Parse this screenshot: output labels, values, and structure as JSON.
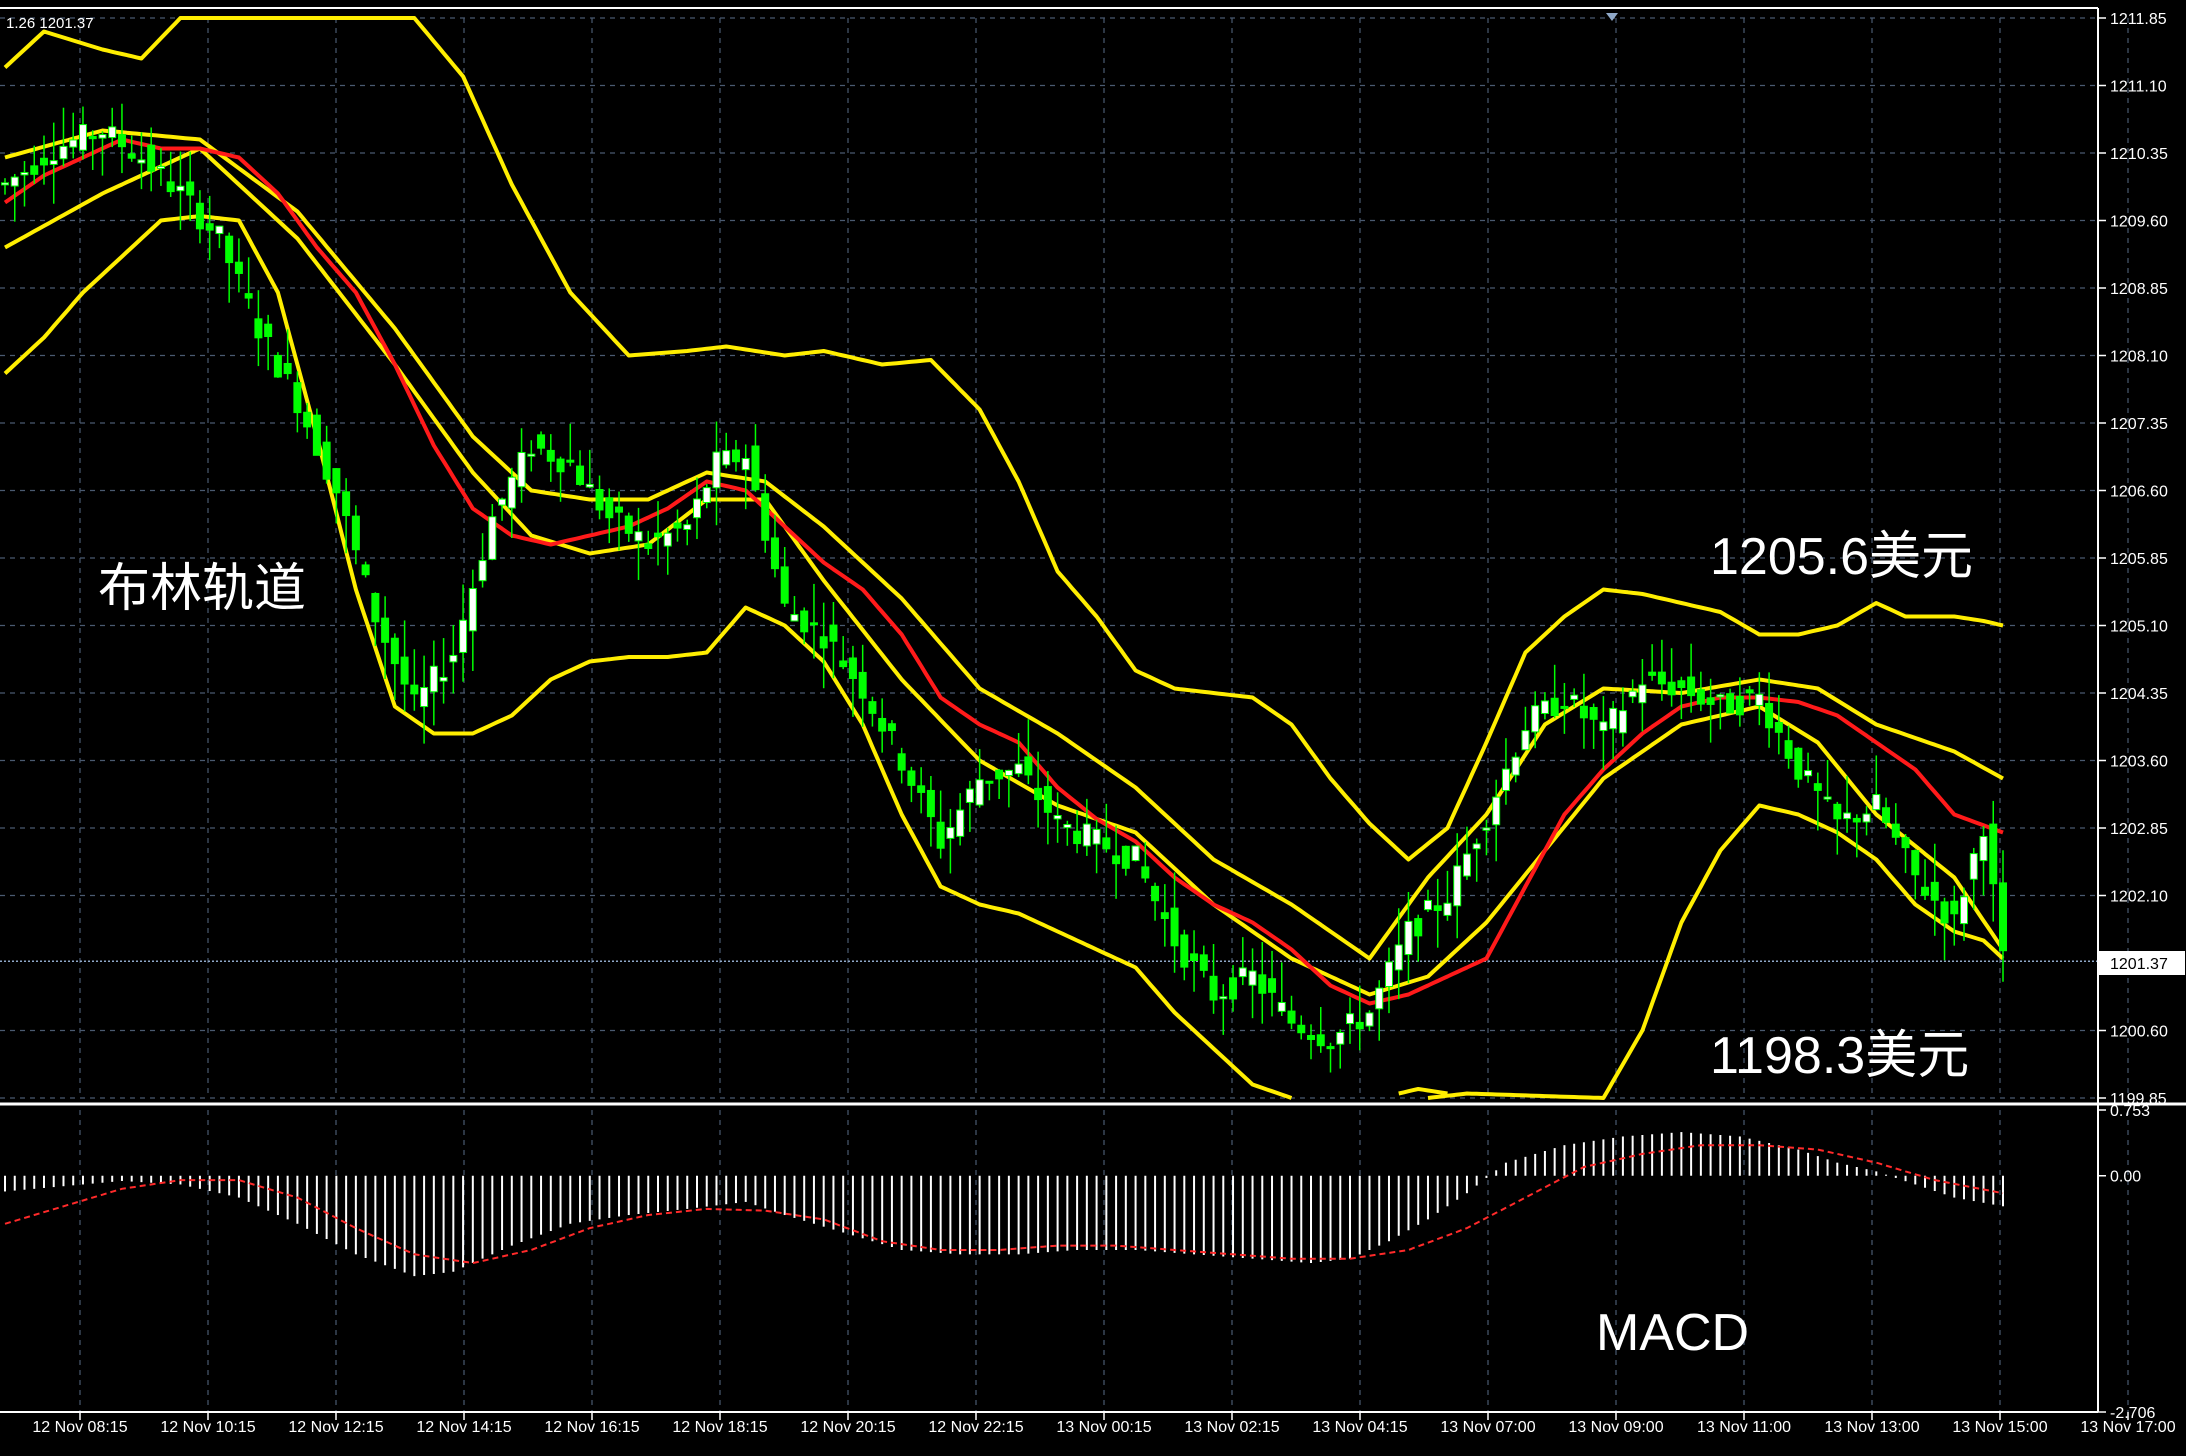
{
  "colors": {
    "background": "#000000",
    "grid": "#4a5a70",
    "axis": "#ffffff",
    "bull_candle": "#ffffff",
    "bear_candle": "#00ff00",
    "wick": "#00ff00",
    "bollinger": "#ffee00",
    "middle_band": "#ff1a1a",
    "macd_hist": "#ffffff",
    "macd_signal": "#ff2a2a",
    "current_price_line": "#8fa8c8",
    "annotation_text": "#ffffff"
  },
  "header": {
    "ohlc_text": "1.26 1201.37"
  },
  "annotations": {
    "bollinger_label": "布林轨道",
    "upper_price_label": "1205.6美元",
    "lower_price_label": "1198.3美元",
    "macd_label": "MACD"
  },
  "current_price": {
    "value": 1201.37,
    "label": "1201.37"
  },
  "chart_data": [
    {
      "type": "candlestick",
      "indicator": "Bollinger Bands",
      "ylim": [
        1199.85,
        1211.85
      ],
      "y_ticks": [
        "1211.85",
        "1211.10",
        "1210.35",
        "1209.60",
        "1208.85",
        "1208.10",
        "1207.35",
        "1206.60",
        "1205.85",
        "1205.10",
        "1204.35",
        "1203.60",
        "1202.85",
        "1202.10",
        "1201.37",
        "1200.60",
        "1199.85"
      ],
      "x_ticks": [
        "12 Nov 08:15",
        "12 Nov 10:15",
        "12 Nov 12:15",
        "12 Nov 14:15",
        "12 Nov 16:15",
        "12 Nov 18:15",
        "12 Nov 20:15",
        "12 Nov 22:15",
        "13 Nov 00:15",
        "13 Nov 02:15",
        "13 Nov 04:15",
        "13 Nov 07:00",
        "13 Nov 09:00",
        "13 Nov 11:00",
        "13 Nov 13:00",
        "13 Nov 15:00",
        "13 Nov 17:00"
      ],
      "price_anchors": [
        [
          0,
          1210.0
        ],
        [
          5,
          1210.4
        ],
        [
          10,
          1210.6
        ],
        [
          14,
          1210.3
        ],
        [
          18,
          1209.9
        ],
        [
          22,
          1209.4
        ],
        [
          26,
          1208.4
        ],
        [
          30,
          1207.6
        ],
        [
          34,
          1206.6
        ],
        [
          38,
          1205.2
        ],
        [
          42,
          1204.2
        ],
        [
          46,
          1204.8
        ],
        [
          50,
          1206.3
        ],
        [
          54,
          1207.1
        ],
        [
          58,
          1206.9
        ],
        [
          62,
          1206.3
        ],
        [
          66,
          1206.0
        ],
        [
          70,
          1206.2
        ],
        [
          73,
          1206.9
        ],
        [
          76,
          1207.0
        ],
        [
          80,
          1205.3
        ],
        [
          84,
          1205.0
        ],
        [
          88,
          1204.4
        ],
        [
          92,
          1203.6
        ],
        [
          96,
          1202.7
        ],
        [
          100,
          1203.4
        ],
        [
          104,
          1203.5
        ],
        [
          108,
          1202.9
        ],
        [
          112,
          1202.7
        ],
        [
          116,
          1202.5
        ],
        [
          120,
          1201.6
        ],
        [
          124,
          1201.0
        ],
        [
          128,
          1201.2
        ],
        [
          132,
          1200.7
        ],
        [
          136,
          1200.5
        ],
        [
          140,
          1200.8
        ],
        [
          144,
          1201.7
        ],
        [
          148,
          1202.1
        ],
        [
          152,
          1203.0
        ],
        [
          156,
          1204.0
        ],
        [
          160,
          1204.3
        ],
        [
          164,
          1203.9
        ],
        [
          168,
          1204.5
        ],
        [
          172,
          1204.4
        ],
        [
          176,
          1204.2
        ],
        [
          180,
          1204.3
        ],
        [
          184,
          1203.5
        ],
        [
          188,
          1202.9
        ],
        [
          192,
          1203.1
        ],
        [
          196,
          1202.3
        ],
        [
          200,
          1201.8
        ],
        [
          203,
          1202.9
        ],
        [
          205,
          1201.37
        ]
      ],
      "upper_band": [
        [
          0,
          1211.3
        ],
        [
          4,
          1211.7
        ],
        [
          10,
          1211.5
        ],
        [
          14,
          1211.4
        ],
        [
          18,
          1211.85
        ],
        [
          30,
          1211.85
        ],
        [
          42,
          1211.85
        ],
        [
          47,
          1211.2
        ],
        [
          52,
          1210.0
        ],
        [
          58,
          1208.8
        ],
        [
          64,
          1208.1
        ],
        [
          70,
          1208.15
        ],
        [
          74,
          1208.2
        ],
        [
          80,
          1208.1
        ],
        [
          84,
          1208.15
        ],
        [
          90,
          1208.0
        ],
        [
          95,
          1208.05
        ],
        [
          100,
          1207.5
        ],
        [
          104,
          1206.7
        ],
        [
          108,
          1205.7
        ],
        [
          112,
          1205.2
        ],
        [
          116,
          1204.6
        ],
        [
          120,
          1204.4
        ],
        [
          124,
          1204.35
        ],
        [
          128,
          1204.3
        ],
        [
          132,
          1204.0
        ],
        [
          136,
          1203.4
        ],
        [
          140,
          1202.9
        ],
        [
          144,
          1202.5
        ],
        [
          148,
          1202.85
        ],
        [
          152,
          1203.8
        ],
        [
          156,
          1204.8
        ],
        [
          160,
          1205.2
        ],
        [
          164,
          1205.5
        ],
        [
          168,
          1205.45
        ],
        [
          172,
          1205.35
        ],
        [
          176,
          1205.25
        ],
        [
          180,
          1205.0
        ],
        [
          184,
          1205.0
        ],
        [
          188,
          1205.1
        ],
        [
          192,
          1205.35
        ],
        [
          195,
          1205.2
        ],
        [
          200,
          1205.2
        ],
        [
          203,
          1205.15
        ],
        [
          205,
          1205.1
        ]
      ],
      "lower_band": [
        [
          0,
          1207.9
        ],
        [
          4,
          1208.3
        ],
        [
          8,
          1208.8
        ],
        [
          12,
          1209.2
        ],
        [
          16,
          1209.6
        ],
        [
          20,
          1209.65
        ],
        [
          24,
          1209.6
        ],
        [
          28,
          1208.8
        ],
        [
          32,
          1207.2
        ],
        [
          36,
          1205.5
        ],
        [
          40,
          1204.2
        ],
        [
          44,
          1203.9
        ],
        [
          48,
          1203.9
        ],
        [
          52,
          1204.1
        ],
        [
          56,
          1204.5
        ],
        [
          60,
          1204.7
        ],
        [
          64,
          1204.75
        ],
        [
          68,
          1204.75
        ],
        [
          72,
          1204.8
        ],
        [
          76,
          1205.3
        ],
        [
          80,
          1205.1
        ],
        [
          84,
          1204.7
        ],
        [
          88,
          1204.0
        ],
        [
          92,
          1203.0
        ],
        [
          96,
          1202.2
        ],
        [
          100,
          1202.0
        ],
        [
          104,
          1201.9
        ],
        [
          108,
          1201.7
        ],
        [
          112,
          1201.5
        ],
        [
          116,
          1201.3
        ],
        [
          120,
          1200.8
        ],
        [
          124,
          1200.4
        ],
        [
          128,
          1200.0
        ],
        [
          132,
          1199.85
        ]
      ],
      "lower_band_tail": [
        [
          146,
          1199.85
        ],
        [
          150,
          1199.9
        ],
        [
          164,
          1199.85
        ],
        [
          168,
          1200.6
        ],
        [
          172,
          1201.8
        ],
        [
          176,
          1202.6
        ],
        [
          180,
          1203.1
        ],
        [
          184,
          1203.0
        ],
        [
          188,
          1202.8
        ],
        [
          192,
          1202.5
        ],
        [
          196,
          1202.0
        ],
        [
          200,
          1201.7
        ],
        [
          203,
          1201.6
        ],
        [
          205,
          1201.4
        ]
      ],
      "lower_band_mid": [
        [
          143,
          1199.9
        ],
        [
          145,
          1199.95
        ],
        [
          148,
          1199.9
        ]
      ],
      "middle_band": [
        [
          0,
          1209.8
        ],
        [
          4,
          1210.1
        ],
        [
          8,
          1210.3
        ],
        [
          12,
          1210.5
        ],
        [
          16,
          1210.4
        ],
        [
          20,
          1210.4
        ],
        [
          24,
          1210.3
        ],
        [
          28,
          1209.9
        ],
        [
          32,
          1209.3
        ],
        [
          36,
          1208.8
        ],
        [
          40,
          1208.0
        ],
        [
          44,
          1207.1
        ],
        [
          48,
          1206.4
        ],
        [
          52,
          1206.1
        ],
        [
          56,
          1206.0
        ],
        [
          60,
          1206.1
        ],
        [
          64,
          1206.2
        ],
        [
          68,
          1206.4
        ],
        [
          72,
          1206.7
        ],
        [
          76,
          1206.6
        ],
        [
          80,
          1206.2
        ],
        [
          84,
          1205.8
        ],
        [
          88,
          1205.5
        ],
        [
          92,
          1205.0
        ],
        [
          96,
          1204.3
        ],
        [
          100,
          1204.0
        ],
        [
          104,
          1203.8
        ],
        [
          108,
          1203.3
        ],
        [
          112,
          1202.95
        ],
        [
          116,
          1202.7
        ],
        [
          120,
          1202.3
        ],
        [
          124,
          1202.0
        ],
        [
          128,
          1201.8
        ],
        [
          132,
          1201.5
        ],
        [
          136,
          1201.1
        ],
        [
          140,
          1200.9
        ],
        [
          144,
          1201.0
        ],
        [
          148,
          1201.2
        ],
        [
          152,
          1201.4
        ],
        [
          156,
          1202.2
        ],
        [
          160,
          1203.0
        ],
        [
          164,
          1203.5
        ],
        [
          168,
          1203.9
        ],
        [
          172,
          1204.2
        ],
        [
          176,
          1204.3
        ],
        [
          180,
          1204.3
        ],
        [
          184,
          1204.25
        ],
        [
          188,
          1204.1
        ],
        [
          192,
          1203.8
        ],
        [
          196,
          1203.5
        ],
        [
          200,
          1203.0
        ],
        [
          205,
          1202.8
        ]
      ],
      "inner_band_upper": [
        [
          0,
          1210.3
        ],
        [
          10,
          1210.6
        ],
        [
          20,
          1210.5
        ],
        [
          30,
          1209.7
        ],
        [
          40,
          1208.4
        ],
        [
          48,
          1207.2
        ],
        [
          54,
          1206.6
        ],
        [
          60,
          1206.5
        ],
        [
          66,
          1206.5
        ],
        [
          72,
          1206.8
        ],
        [
          78,
          1206.7
        ],
        [
          84,
          1206.2
        ],
        [
          92,
          1205.4
        ],
        [
          100,
          1204.4
        ],
        [
          108,
          1203.9
        ],
        [
          116,
          1203.3
        ],
        [
          124,
          1202.5
        ],
        [
          132,
          1202.0
        ],
        [
          140,
          1201.4
        ],
        [
          146,
          1202.3
        ],
        [
          152,
          1203.0
        ],
        [
          158,
          1204.0
        ],
        [
          164,
          1204.4
        ],
        [
          172,
          1204.35
        ],
        [
          180,
          1204.5
        ],
        [
          186,
          1204.4
        ],
        [
          192,
          1204.0
        ],
        [
          200,
          1203.7
        ],
        [
          205,
          1203.4
        ]
      ],
      "inner_band_lower": [
        [
          0,
          1209.3
        ],
        [
          10,
          1209.9
        ],
        [
          20,
          1210.4
        ],
        [
          30,
          1209.4
        ],
        [
          40,
          1208.0
        ],
        [
          48,
          1206.8
        ],
        [
          54,
          1206.1
        ],
        [
          60,
          1205.9
        ],
        [
          66,
          1206.0
        ],
        [
          72,
          1206.5
        ],
        [
          78,
          1206.5
        ],
        [
          84,
          1205.6
        ],
        [
          92,
          1204.5
        ],
        [
          100,
          1203.6
        ],
        [
          108,
          1203.1
        ],
        [
          116,
          1202.8
        ],
        [
          124,
          1202.0
        ],
        [
          132,
          1201.4
        ],
        [
          140,
          1201.0
        ],
        [
          146,
          1201.2
        ],
        [
          152,
          1201.8
        ],
        [
          158,
          1202.6
        ],
        [
          164,
          1203.4
        ],
        [
          172,
          1204.0
        ],
        [
          180,
          1204.2
        ],
        [
          186,
          1203.8
        ],
        [
          192,
          1203.0
        ],
        [
          200,
          1202.3
        ],
        [
          205,
          1201.5
        ]
      ]
    },
    {
      "type": "bar",
      "indicator": "MACD",
      "ylim": [
        -2.706,
        0.753
      ],
      "y_ticks": [
        "0.753",
        "0.00",
        "-2.706"
      ],
      "histogram_anchors": [
        [
          0,
          -0.18
        ],
        [
          6,
          -0.12
        ],
        [
          12,
          -0.06
        ],
        [
          18,
          -0.1
        ],
        [
          24,
          -0.25
        ],
        [
          30,
          -0.55
        ],
        [
          36,
          -0.9
        ],
        [
          42,
          -1.15
        ],
        [
          46,
          -1.1
        ],
        [
          52,
          -0.8
        ],
        [
          58,
          -0.55
        ],
        [
          64,
          -0.45
        ],
        [
          70,
          -0.38
        ],
        [
          76,
          -0.3
        ],
        [
          80,
          -0.45
        ],
        [
          86,
          -0.65
        ],
        [
          92,
          -0.85
        ],
        [
          98,
          -0.9
        ],
        [
          104,
          -0.9
        ],
        [
          110,
          -0.85
        ],
        [
          116,
          -0.85
        ],
        [
          122,
          -0.9
        ],
        [
          128,
          -0.95
        ],
        [
          134,
          -1.0
        ],
        [
          138,
          -0.95
        ],
        [
          142,
          -0.75
        ],
        [
          146,
          -0.5
        ],
        [
          150,
          -0.2
        ],
        [
          154,
          0.15
        ],
        [
          160,
          0.35
        ],
        [
          166,
          0.45
        ],
        [
          172,
          0.5
        ],
        [
          178,
          0.45
        ],
        [
          184,
          0.3
        ],
        [
          188,
          0.15
        ],
        [
          192,
          0.05
        ],
        [
          196,
          -0.1
        ],
        [
          200,
          -0.25
        ],
        [
          205,
          -0.35
        ]
      ],
      "signal_anchors": [
        [
          0,
          -0.55
        ],
        [
          6,
          -0.35
        ],
        [
          12,
          -0.15
        ],
        [
          18,
          -0.05
        ],
        [
          24,
          -0.05
        ],
        [
          30,
          -0.25
        ],
        [
          36,
          -0.6
        ],
        [
          42,
          -0.9
        ],
        [
          48,
          -1.0
        ],
        [
          54,
          -0.85
        ],
        [
          60,
          -0.6
        ],
        [
          66,
          -0.45
        ],
        [
          72,
          -0.38
        ],
        [
          78,
          -0.4
        ],
        [
          84,
          -0.5
        ],
        [
          90,
          -0.75
        ],
        [
          96,
          -0.85
        ],
        [
          102,
          -0.85
        ],
        [
          108,
          -0.8
        ],
        [
          114,
          -0.8
        ],
        [
          120,
          -0.85
        ],
        [
          126,
          -0.9
        ],
        [
          132,
          -0.95
        ],
        [
          138,
          -0.95
        ],
        [
          144,
          -0.85
        ],
        [
          150,
          -0.6
        ],
        [
          156,
          -0.25
        ],
        [
          162,
          0.1
        ],
        [
          168,
          0.25
        ],
        [
          174,
          0.35
        ],
        [
          180,
          0.35
        ],
        [
          186,
          0.3
        ],
        [
          192,
          0.15
        ],
        [
          198,
          -0.05
        ],
        [
          205,
          -0.2
        ]
      ]
    }
  ]
}
